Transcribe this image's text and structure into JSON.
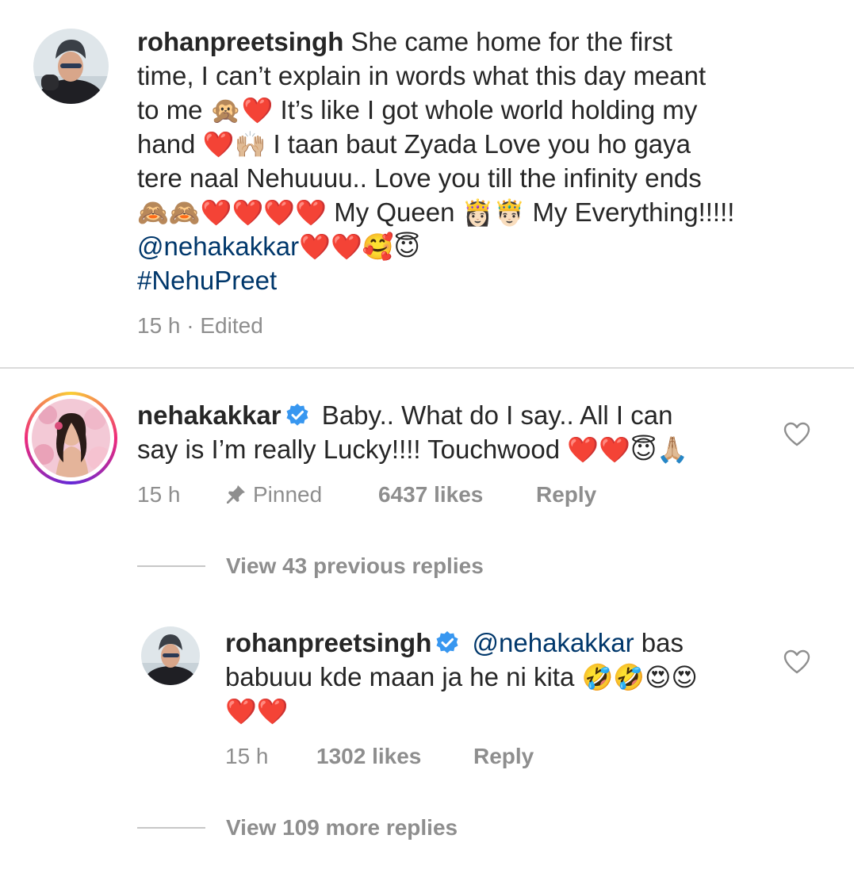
{
  "caption": {
    "username": "rohanpreetsingh",
    "line1": " She came home for the first",
    "line2": "time, I can’t explain in words what this day meant",
    "line3a": "to me ",
    "line3_emoji": "🙊❤️",
    "line3b": " It’s like I got whole world holding my",
    "line4a": "hand ",
    "line4_emoji": "❤️🙌🏼",
    "line4b": " I taan baut Zyada Love you ho gaya",
    "line5": "tere naal Nehuuuu.. Love you till the infinity ends",
    "line6_emoji": "🙈🙈❤️❤️❤️❤️",
    "line6a": " My Queen ",
    "line6_emoji2": "👸🏻",
    "line6b_emoji": " 🤴🏻",
    "line6c": " My Everything!!!!!",
    "mention": "@nehakakkar",
    "mention_emoji": " ❤️❤️🥰😇",
    "hashtag": "#NehuPreet",
    "meta": "15 h · Edited"
  },
  "comment1": {
    "username": "nehakakkar",
    "line1": " Baby.. What do I say.. All I can",
    "line2a": "say is I’m really Lucky!!!! Touchwood ",
    "line2_emoji": "❤️❤️😇🙏🏼",
    "time": "15 h",
    "pinned": "Pinned",
    "likes": "6437 likes",
    "reply": "Reply",
    "view_replies": "View 43 previous replies"
  },
  "reply1": {
    "username": "rohanpreetsingh",
    "mention": " @nehakakkar",
    "line1b": " bas",
    "line2a": "babuuu kde maan ja he ni kita ",
    "line2_emoji": "🤣🤣😍😍",
    "line3_emoji": "❤️❤️",
    "time": "15 h",
    "likes": "1302 likes",
    "reply": "Reply",
    "view_replies": "View 109 more replies"
  },
  "colors": {
    "link": "#00376b",
    "text": "#262626",
    "muted": "#8e8e8e",
    "verified": "#3897f0"
  }
}
